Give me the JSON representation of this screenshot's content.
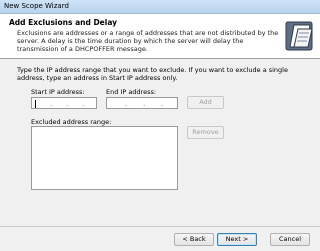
{
  "window": {
    "title": "New Scope Wizard"
  },
  "header": {
    "title": "Add Exclusions and Delay",
    "description": "Exclusions are addresses or a range of addresses that are not distributed by the server. A delay is the time duration by which the server will delay the transmission of a DHCPOFFER message.",
    "icon": "wizard-book-icon"
  },
  "main": {
    "instructions": "Type the IP address range that you want to exclude. If you want to exclude a single address, type an address in Start IP address only.",
    "start_ip": {
      "label": "Start IP address:",
      "value": ""
    },
    "end_ip": {
      "label": "End IP address:",
      "value": ""
    },
    "add_label": "Add",
    "excluded_label": "Excluded address range:",
    "excluded_items": [],
    "remove_label": "Remove"
  },
  "footer": {
    "back_label": "< Back",
    "next_label": "Next >",
    "cancel_label": "Cancel"
  }
}
